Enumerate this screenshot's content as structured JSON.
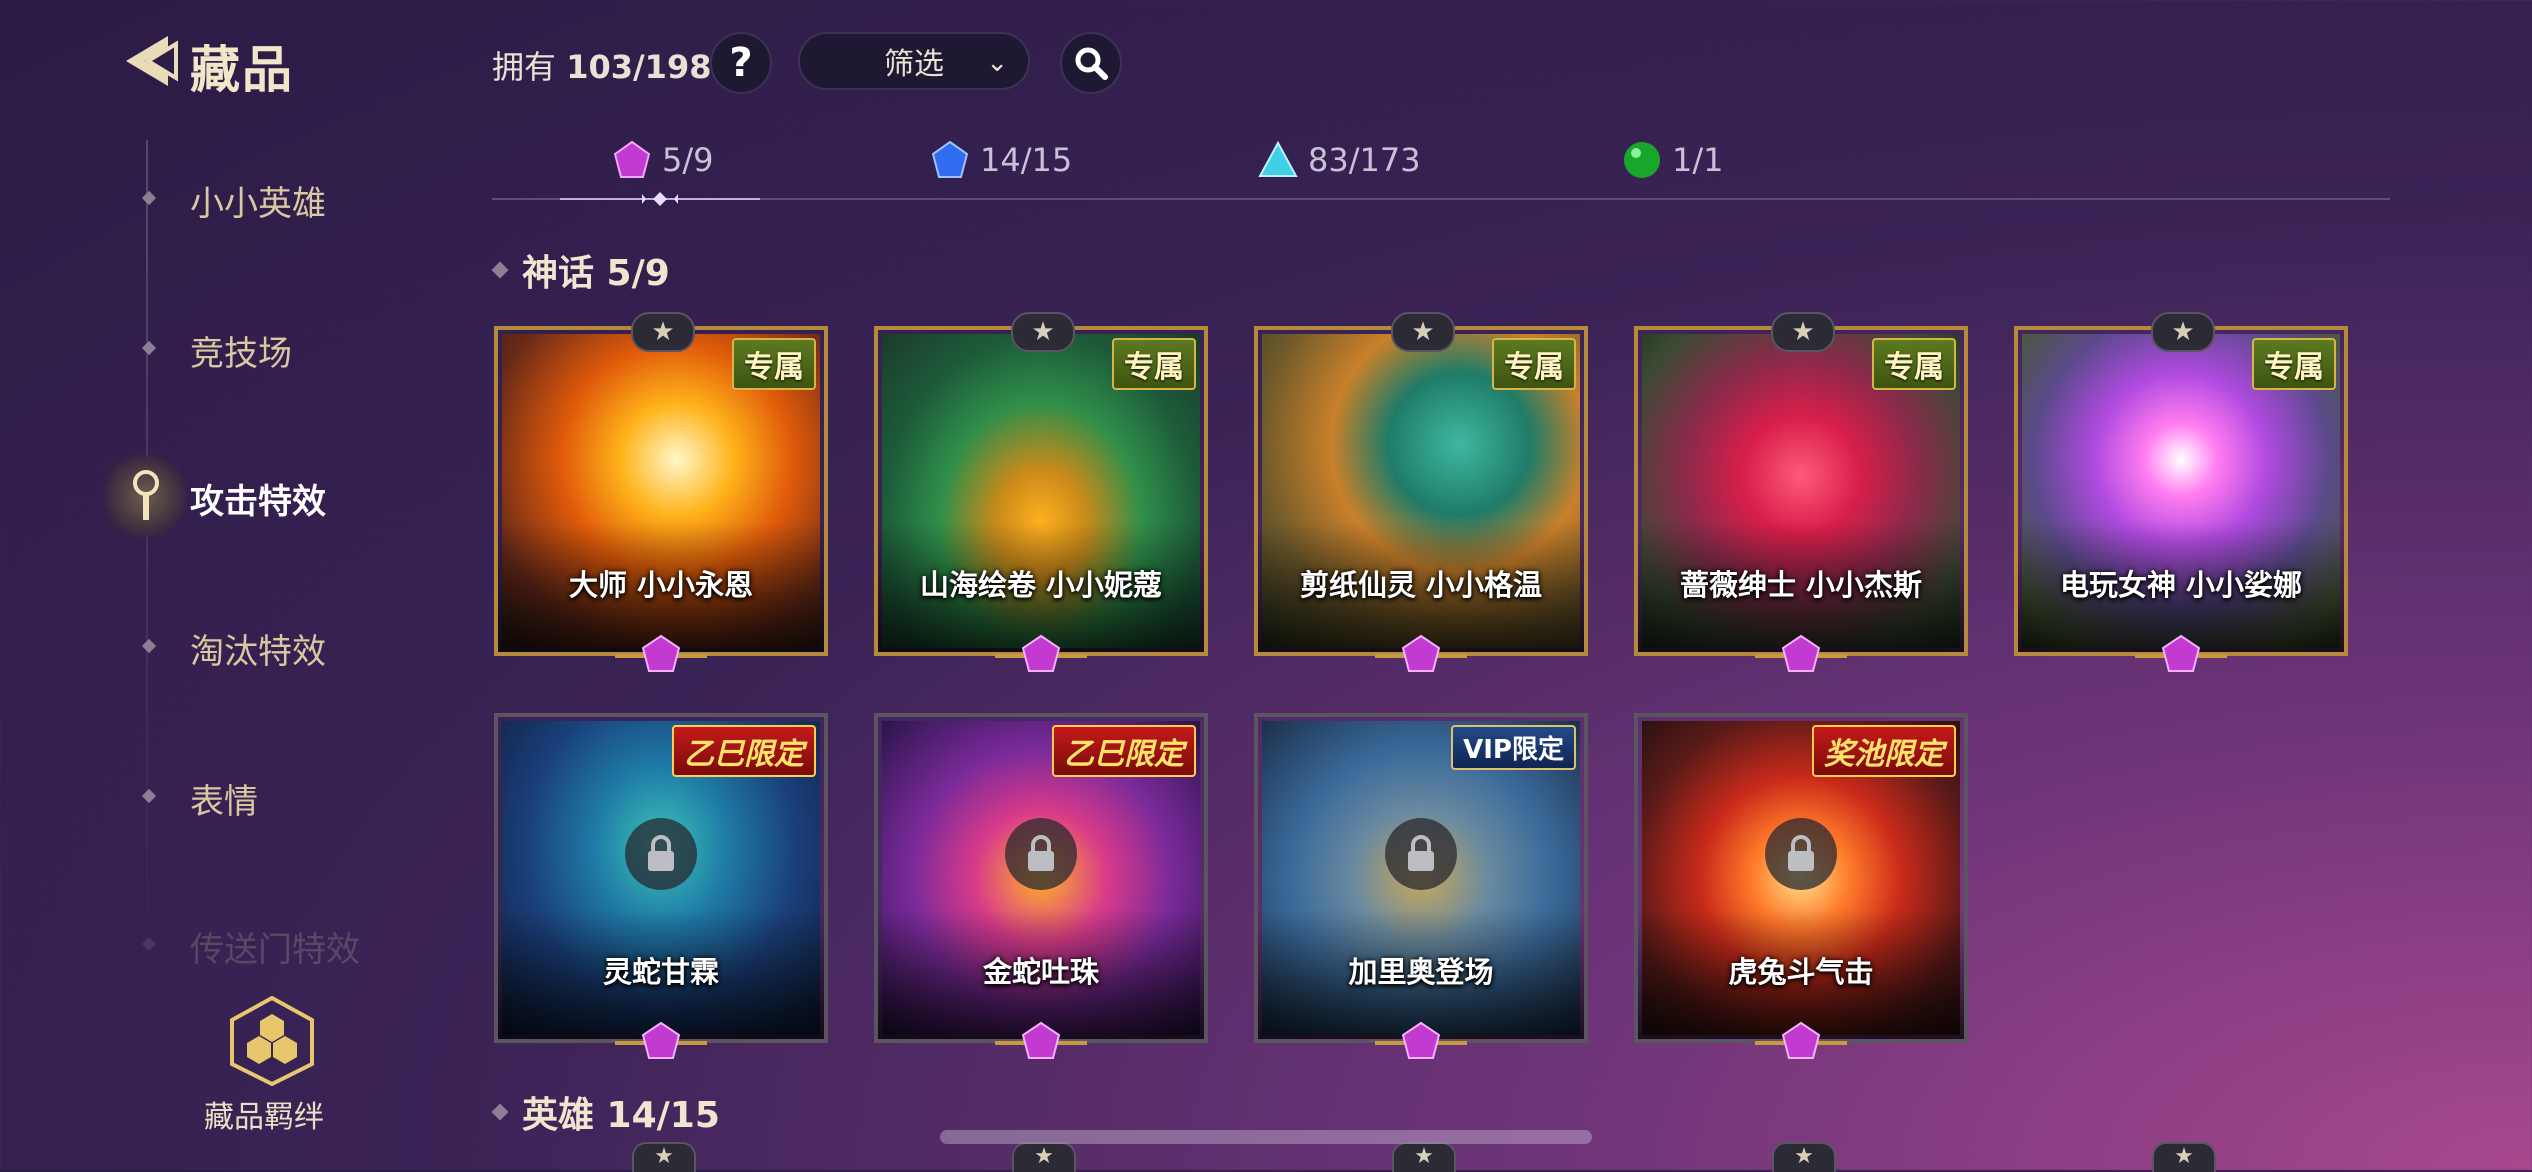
{
  "header": {
    "title": "藏品",
    "owned_prefix": "拥有",
    "owned_count": "103/198",
    "help_symbol": "?",
    "filter_label": "筛选"
  },
  "nav": {
    "items": [
      {
        "label": "小小英雄"
      },
      {
        "label": "竞技场"
      },
      {
        "label": "攻击特效"
      },
      {
        "label": "淘汰特效"
      },
      {
        "label": "表情"
      },
      {
        "label": "传送门特效"
      }
    ],
    "bond_label": "藏品羁绊"
  },
  "tabs": [
    {
      "count": "5/9",
      "gem": "mythic-gem-icon",
      "color": "#c23ad0"
    },
    {
      "count": "14/15",
      "gem": "legendary-gem-icon",
      "color": "#2f6cf0"
    },
    {
      "count": "83/173",
      "gem": "epic-gem-icon",
      "color": "#3fd0e8"
    },
    {
      "count": "1/1",
      "gem": "green-orb-icon",
      "color": "#17a82b"
    }
  ],
  "sections": {
    "mythic": "神话 5/9",
    "hero": "英雄 14/15"
  },
  "cards": [
    {
      "name": "大师 小小永恩",
      "tag": "专属",
      "tag_type": "excl",
      "locked": false
    },
    {
      "name": "山海绘卷 小小妮蔻",
      "tag": "专属",
      "tag_type": "excl",
      "locked": false
    },
    {
      "name": "剪纸仙灵 小小格温",
      "tag": "专属",
      "tag_type": "excl",
      "locked": false
    },
    {
      "name": "蔷薇绅士 小小杰斯",
      "tag": "专属",
      "tag_type": "excl",
      "locked": false
    },
    {
      "name": "电玩女神 小小娑娜",
      "tag": "专属",
      "tag_type": "excl",
      "locked": false
    },
    {
      "name": "灵蛇甘霖",
      "tag": "乙巳限定",
      "tag_type": "limited",
      "locked": true
    },
    {
      "name": "金蛇吐珠",
      "tag": "乙巳限定",
      "tag_type": "limited",
      "locked": true
    },
    {
      "name": "加里奥登场",
      "tag": "VIP限定",
      "tag_type": "vip",
      "locked": true
    },
    {
      "name": "虎兔斗气击",
      "tag": "奖池限定",
      "tag_type": "limited",
      "locked": true
    }
  ],
  "colors": {
    "gold_frame": "#b68a3b",
    "accent_text": "#d9c9a0",
    "mythic": "#c23ad0"
  }
}
